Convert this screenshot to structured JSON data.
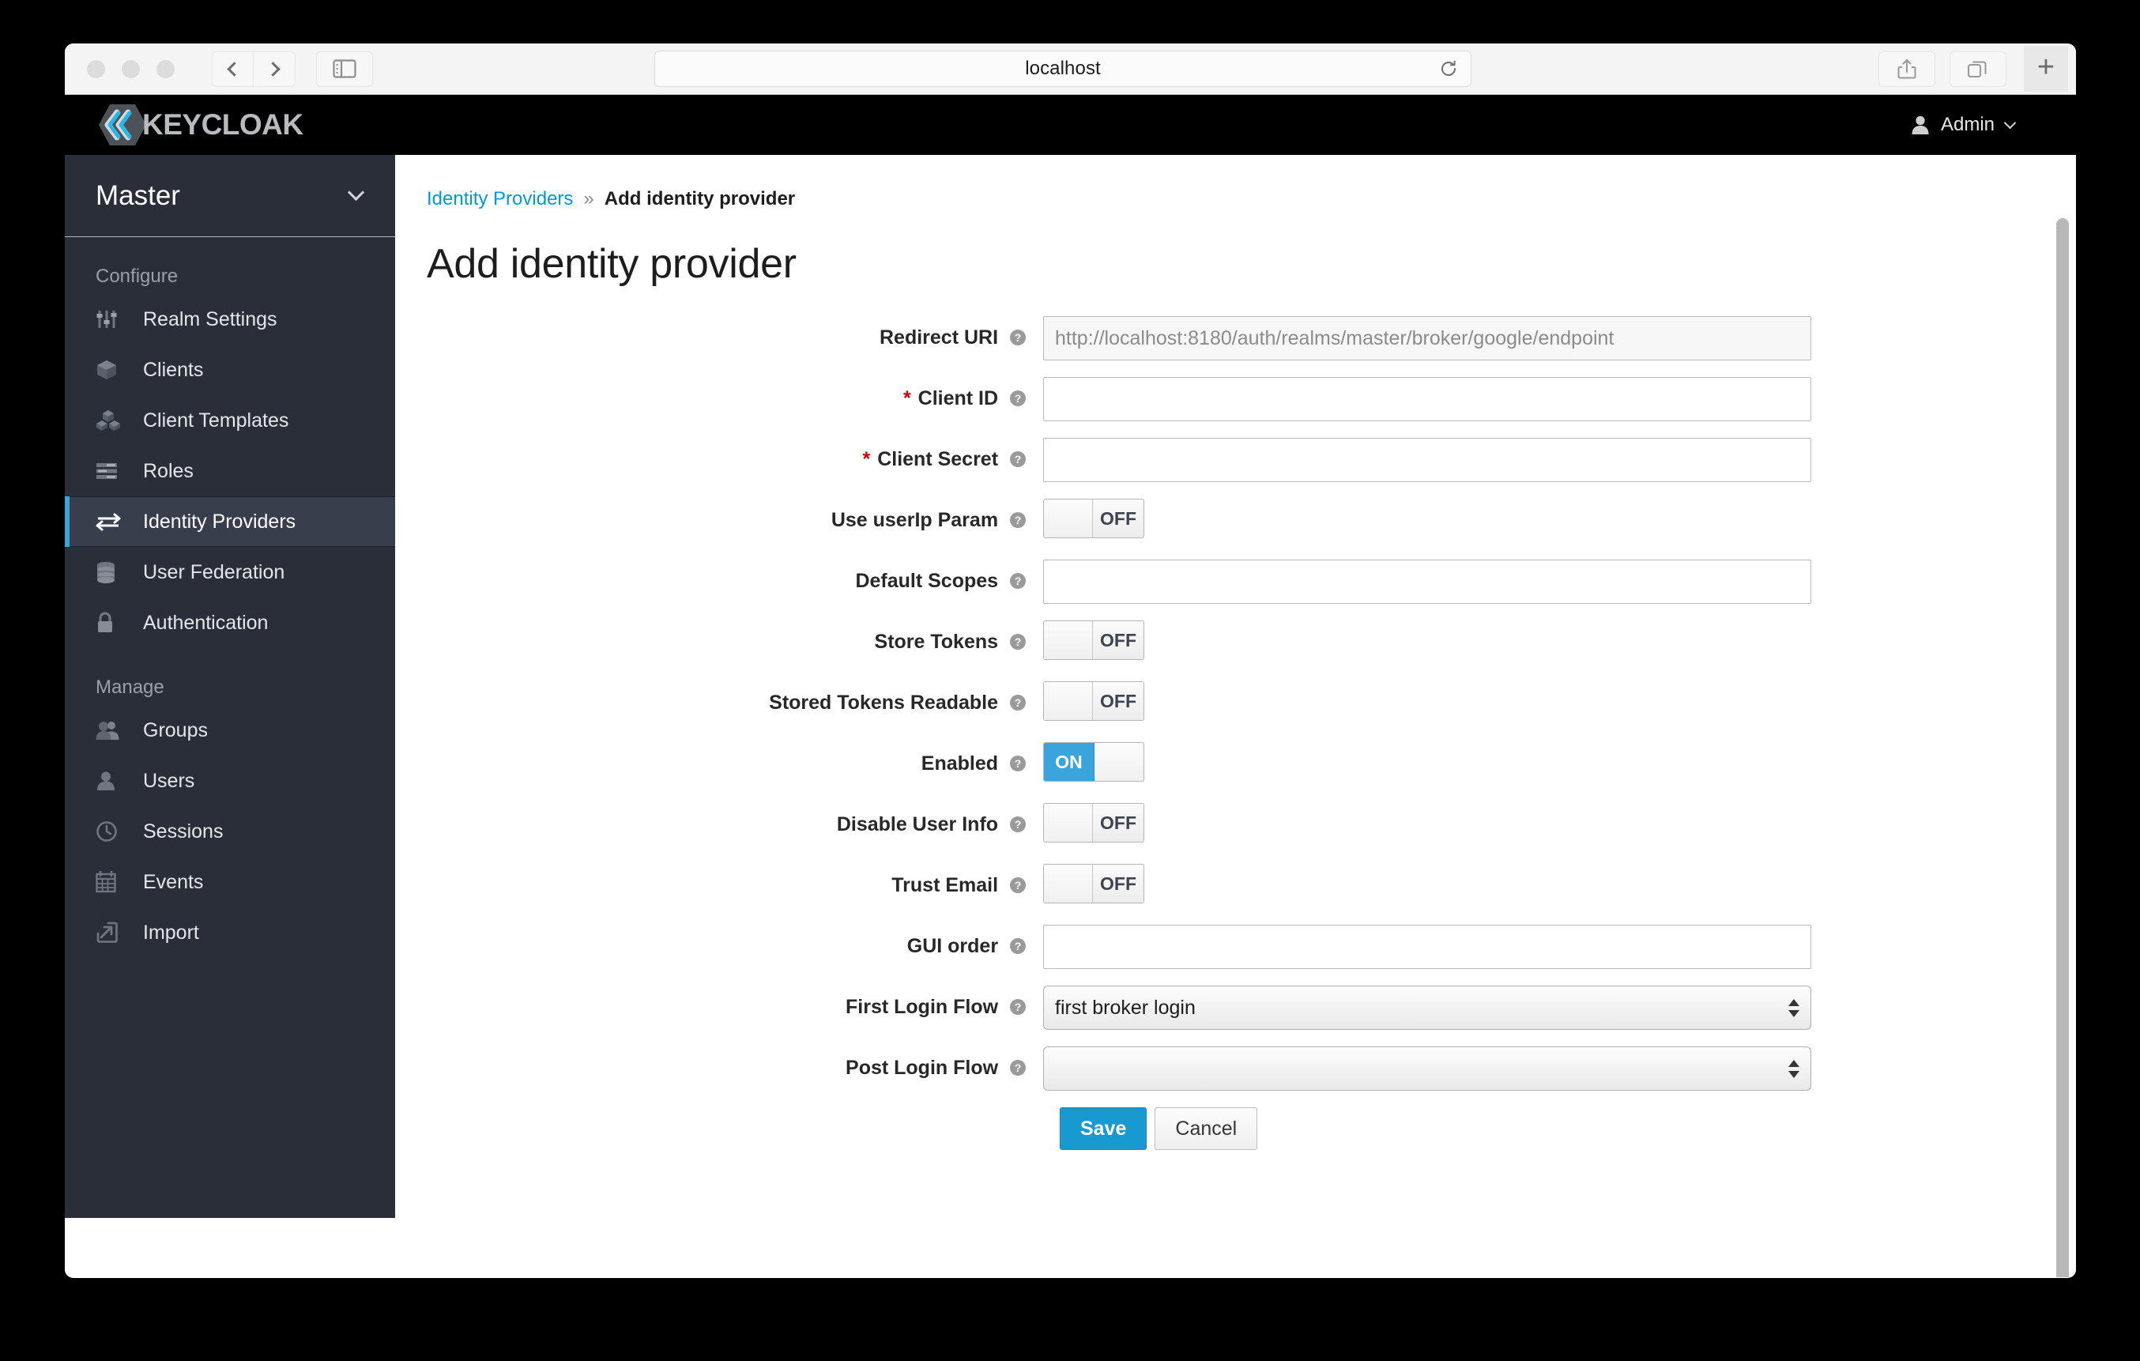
{
  "browser": {
    "address_value": "localhost",
    "icons": {
      "back": "chevron-left-icon",
      "forward": "chevron-right-icon",
      "sidebar": "sidebar-toggle-icon",
      "reload": "reload-icon",
      "share": "share-icon",
      "tabs": "tab-overview-icon",
      "new_tab": "+"
    }
  },
  "header": {
    "logo_text": "KEYCLOAK",
    "user_label": "Admin"
  },
  "sidebar": {
    "realm": "Master",
    "sections": [
      {
        "title": "Configure",
        "items": [
          {
            "label": "Realm Settings",
            "icon": "sliders-icon",
            "active": false
          },
          {
            "label": "Clients",
            "icon": "cube-icon",
            "active": false
          },
          {
            "label": "Client Templates",
            "icon": "cubes-icon",
            "active": false
          },
          {
            "label": "Roles",
            "icon": "list-icon",
            "active": false
          },
          {
            "label": "Identity Providers",
            "icon": "exchange-icon",
            "active": true
          },
          {
            "label": "User Federation",
            "icon": "database-icon",
            "active": false
          },
          {
            "label": "Authentication",
            "icon": "lock-icon",
            "active": false
          }
        ]
      },
      {
        "title": "Manage",
        "items": [
          {
            "label": "Groups",
            "icon": "users-icon",
            "active": false
          },
          {
            "label": "Users",
            "icon": "user-icon",
            "active": false
          },
          {
            "label": "Sessions",
            "icon": "clock-icon",
            "active": false
          },
          {
            "label": "Events",
            "icon": "calendar-icon",
            "active": false
          },
          {
            "label": "Import",
            "icon": "import-icon",
            "active": false
          }
        ]
      }
    ]
  },
  "breadcrumb": {
    "parent": "Identity Providers",
    "separator": "»",
    "current": "Add identity provider"
  },
  "page": {
    "title": "Add identity provider"
  },
  "form": {
    "rows": [
      {
        "label": "Redirect URI",
        "required": false,
        "type": "text-readonly",
        "value": "http://localhost:8180/auth/realms/master/broker/google/endpoint"
      },
      {
        "label": "Client ID",
        "required": true,
        "type": "text",
        "value": ""
      },
      {
        "label": "Client Secret",
        "required": true,
        "type": "text",
        "value": ""
      },
      {
        "label": "Use userIp Param",
        "required": false,
        "type": "toggle",
        "value": "OFF"
      },
      {
        "label": "Default Scopes",
        "required": false,
        "type": "text",
        "value": ""
      },
      {
        "label": "Store Tokens",
        "required": false,
        "type": "toggle",
        "value": "OFF"
      },
      {
        "label": "Stored Tokens Readable",
        "required": false,
        "type": "toggle",
        "value": "OFF"
      },
      {
        "label": "Enabled",
        "required": false,
        "type": "toggle",
        "value": "ON"
      },
      {
        "label": "Disable User Info",
        "required": false,
        "type": "toggle",
        "value": "OFF"
      },
      {
        "label": "Trust Email",
        "required": false,
        "type": "toggle",
        "value": "OFF"
      },
      {
        "label": "GUI order",
        "required": false,
        "type": "text",
        "value": ""
      },
      {
        "label": "First Login Flow",
        "required": false,
        "type": "select",
        "value": "first broker login"
      },
      {
        "label": "Post Login Flow",
        "required": false,
        "type": "select",
        "value": ""
      }
    ],
    "help_icon": "help-circle-icon",
    "save_label": "Save",
    "cancel_label": "Cancel"
  },
  "colors": {
    "accent_blue": "#39a5dc",
    "link_blue": "#0099d3",
    "sidebar_bg": "#292e39",
    "required_red": "#cc0000"
  }
}
